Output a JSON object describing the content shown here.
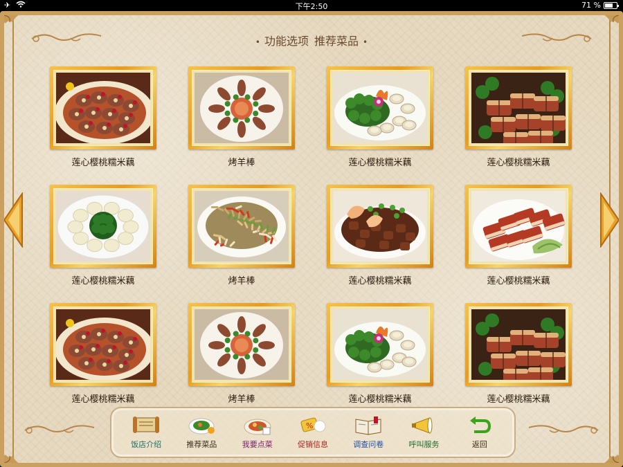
{
  "status_bar": {
    "time": "下午2:50",
    "battery_text": "71 %",
    "battery_level": 0.71
  },
  "header": {
    "section": "功能选项",
    "current": "推荐菜品"
  },
  "dishes": [
    {
      "name": "莲心樱桃糯米藕",
      "photo": "lotus-root-cherry"
    },
    {
      "name": "烤羊棒",
      "photo": "lamb-rack"
    },
    {
      "name": "莲心樱桃糯米藕",
      "photo": "scallops-broccoli"
    },
    {
      "name": "莲心樱桃糯米藕",
      "photo": "braised-pork"
    },
    {
      "name": "莲心樱桃糯米藕",
      "photo": "broccoli-ring"
    },
    {
      "name": "烤羊棒",
      "photo": "stir-fry-beans"
    },
    {
      "name": "莲心樱桃糯米藕",
      "photo": "shrimp-peas"
    },
    {
      "name": "莲心樱桃糯米藕",
      "photo": "roast-pork-slices"
    },
    {
      "name": "莲心樱桃糯米藕",
      "photo": "lotus-root-cherry"
    },
    {
      "name": "烤羊棒",
      "photo": "lamb-rack"
    },
    {
      "name": "莲心樱桃糯米藕",
      "photo": "scallops-broccoli"
    },
    {
      "name": "莲心樱桃糯米藕",
      "photo": "braised-pork"
    }
  ],
  "toolbar": [
    {
      "label": "饭店介绍",
      "icon": "scroll-icon",
      "color": "#1f6e6a"
    },
    {
      "label": "推荐菜品",
      "icon": "dish-icon",
      "color": "#3b2a1a"
    },
    {
      "label": "我要点菜",
      "icon": "order-icon",
      "color": "#7a1e6a"
    },
    {
      "label": "促销信息",
      "icon": "promo-icon",
      "color": "#b21e1e"
    },
    {
      "label": "调查问卷",
      "icon": "book-icon",
      "color": "#1e4fa8"
    },
    {
      "label": "呼叫服务",
      "icon": "megaphone-icon",
      "color": "#1e6e2a"
    },
    {
      "label": "返回",
      "icon": "back-icon",
      "color": "#3b2a1a"
    }
  ],
  "colors": {
    "accent_gold": "#e89b1e",
    "background": "#e6d9c0",
    "header_text": "#6b4a2b"
  }
}
